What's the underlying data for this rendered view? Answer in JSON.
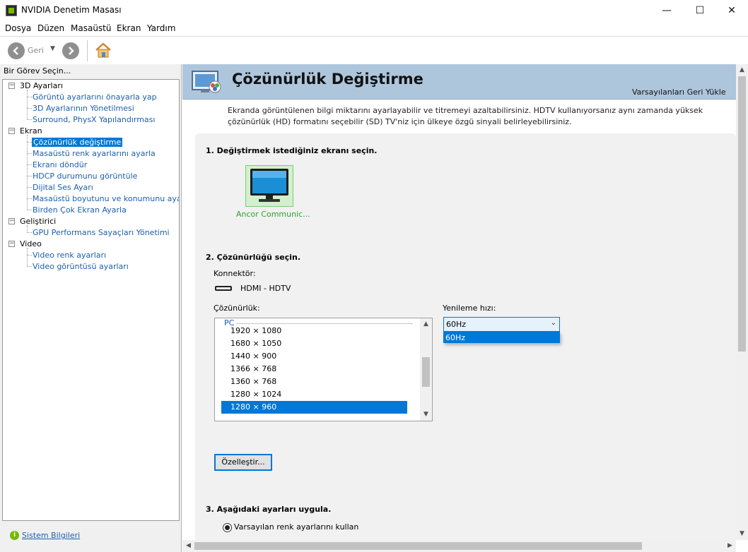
{
  "window": {
    "title": "NVIDIA Denetim Masası",
    "controls": {
      "minimize": "—",
      "maximize": "☐",
      "close": "✕"
    }
  },
  "menu": [
    "Dosya",
    "Düzen",
    "Masaüstü",
    "Ekran",
    "Yardım"
  ],
  "toolbar": {
    "back_label": "Geri",
    "back_icon": "back-arrow-icon",
    "forward_icon": "forward-arrow-icon",
    "home_icon": "home-icon"
  },
  "sidebar": {
    "header": "Bir Görev Seçin...",
    "categories": [
      {
        "label": "3D Ayarları",
        "items": [
          "Görüntü ayarlarını önayarla yap",
          "3D Ayarlarının Yönetilmesi",
          "Surround, PhysX Yapılandırması"
        ]
      },
      {
        "label": "Ekran",
        "items": [
          "Çözünürlük değiştirme",
          "Masaüstü renk ayarlarını ayarla",
          "Ekranı döndür",
          "HDCP durumunu görüntüle",
          "Dijital Ses Ayarı",
          "Masaüstü boyutunu ve konumunu ayarla",
          "Birden Çok Ekran Ayarla"
        ]
      },
      {
        "label": "Geliştirici",
        "items": [
          "GPU Performans Sayaçları Yönetimi"
        ]
      },
      {
        "label": "Video",
        "items": [
          "Video renk ayarları",
          "Video görüntüsü ayarları"
        ]
      }
    ],
    "selected": "Çözünürlük değiştirme",
    "expander": "−",
    "system_info_link": "Sistem Bilgileri"
  },
  "page": {
    "title": "Çözünürlük Değiştirme",
    "restore_defaults": "Varsayılanları Geri Yükle",
    "description": "Ekranda görüntülenen bilgi miktarını ayarlayabilir ve titremeyi azaltabilirsiniz. HDTV kullanıyorsanız aynı zamanda yüksek çözünürlük (HD) formatını seçebilir (SD) TV'niz için ülkeye özgü sinyali belirleyebilirsiniz.",
    "step1": "1. Değiştirmek istediğiniz ekranı seçin.",
    "display_name": "Ancor Communic...",
    "step2": "2. Çözünürlüğü seçin.",
    "connector_label": "Konnektör:",
    "connector_value": "HDMI - HDTV",
    "resolution_label": "Çözünürlük:",
    "resolution_group": "PC",
    "resolutions": [
      "1920 × 1080",
      "1680 × 1050",
      "1440 × 900",
      "1366 × 768",
      "1360 × 768",
      "1280 × 1024",
      "1280 × 960"
    ],
    "selected_resolution": "1280 × 960",
    "refresh_label": "Yenileme hızı:",
    "refresh_value": "60Hz",
    "refresh_options": [
      "60Hz"
    ],
    "customize_button": "Özelleştir...",
    "step3": "3. Aşağıdaki ayarları uygula.",
    "radio_default_label": "Varsayılan renk ayarlarını kullan"
  },
  "colors": {
    "selection": "#0078d7",
    "link": "#1c5fad",
    "header_band": "#aec6dc",
    "display_tile": "#d2f0cc",
    "display_label": "#29a32a"
  }
}
